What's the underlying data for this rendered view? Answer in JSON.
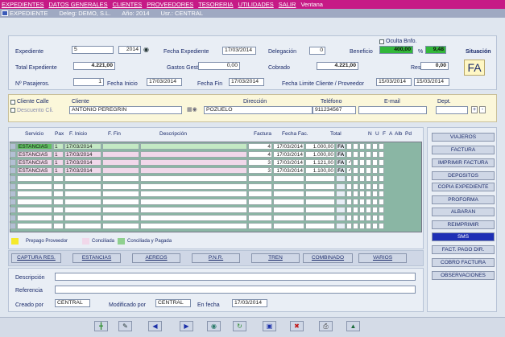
{
  "menu": [
    "EXPEDIENTES",
    "DATOS GENERALES",
    "CLIENTES",
    "PROVEEDORES",
    "TESORERIA",
    "UTILIDADES",
    "SALIR",
    "Ventana"
  ],
  "window": {
    "title": "EXPEDIENTE",
    "deleg": "Deleg: DEMO, S.L.",
    "year": "Año: 2014",
    "user": "Usr.: CENTRAL"
  },
  "header": {
    "expediente_label": "Expediente",
    "expediente_num": "5",
    "expediente_year": "2014",
    "fecha_exp_label": "Fecha Expediente",
    "fecha_exp": "17/03/2014",
    "delegacion_label": "Delegación",
    "delegacion": "0",
    "oculta_label": "Oculta Bnfo.",
    "beneficio_label": "Beneficio",
    "beneficio": "400,00",
    "pct_label": "%",
    "pct": "9,48",
    "situacion_label": "Situación",
    "situacion": "FA",
    "total_label": "Total Expediente",
    "total": "4.221,00",
    "gastos_label": "Gastos Gestión",
    "gastos": "0,00",
    "cobrado_label": "Cobrado",
    "cobrado": "4.221,00",
    "resto_label": "Resto",
    "resto": "0,00",
    "pasajeros_label": "Nº Pasajeros.",
    "pasajeros": "1",
    "fecha_inicio_label": "Fecha Inicio",
    "fecha_inicio": "17/03/2014",
    "fecha_fin_label": "Fecha Fin",
    "fecha_fin": "17/03/2014",
    "fecha_limite_label": "Fecha Limite Cliente / Proveedor",
    "fecha_limite_cli": "15/03/2014",
    "fecha_limite_prov": "15/03/2014"
  },
  "client": {
    "cliente_calle_label": "Cliente Calle",
    "descuento_label": "Descuento Cli.",
    "cliente_label": "Cliente",
    "cliente": "ANTONIO PEREGRIN",
    "direccion_label": "Dirección",
    "direccion": "POZUELO",
    "telefono_label": "Teléfono",
    "telefono": "911234567",
    "email_label": "E-mail",
    "email": "",
    "dept_label": "Dept.",
    "dept": ""
  },
  "services": {
    "columns": [
      "Servicio",
      "Pax",
      "F. Inicio",
      "F. Fin",
      "Descripción",
      "Factura",
      "Fecha Fac.",
      "Total",
      "N",
      "U",
      "F",
      "A",
      "Alb",
      "Pd"
    ],
    "rows": [
      {
        "servicio": "ESTANCIAS",
        "pax": "1",
        "inicio": "17/03/2014",
        "fin": "",
        "desc": "",
        "factura": "4",
        "fecha": "17/03/2014",
        "total": "1.000,00",
        "flag": "FA"
      },
      {
        "servicio": "ESTANCIAS",
        "pax": "1",
        "inicio": "17/03/2014",
        "fin": "",
        "desc": "",
        "factura": "4",
        "fecha": "17/03/2014",
        "total": "1.000,00",
        "flag": "FA"
      },
      {
        "servicio": "ESTANCIAS",
        "pax": "1",
        "inicio": "17/03/2014",
        "fin": "",
        "desc": "",
        "factura": "3",
        "fecha": "17/03/2014",
        "total": "1.121,00",
        "flag": "FA"
      },
      {
        "servicio": "ESTANCIAS",
        "pax": "1",
        "inicio": "17/03/2014",
        "fin": "",
        "desc": "",
        "factura": "3",
        "fecha": "17/03/2014",
        "total": "1.100,00",
        "flag": "FA"
      }
    ]
  },
  "legend": [
    "Prepago Proveedor",
    "Conciliada",
    "Conciliada y Pagada"
  ],
  "legend_colors": [
    "#f5e92a",
    "#f1d8ea",
    "#8fd08f"
  ],
  "bottom_tabs": [
    "CAPTURA RES.",
    "ESTANCIAS",
    "AEREOS",
    "P.N.R.",
    "TREN",
    "COMBINADO",
    "VARIOS"
  ],
  "side_buttons": [
    "VIAJEROS",
    "FACTURA",
    "IMPRIMIR FACTURA",
    "DEPOSITOS",
    "COPIA EXPEDIENTE",
    "PROFORMA",
    "ALBARAN",
    "REIMPRIMIR",
    "SMS",
    "FACT. PAGO DIR.",
    "COBRO FACTURA",
    "OBSERVACIONES"
  ],
  "footer": {
    "descripcion_label": "Descripción",
    "descripcion": "",
    "referencia_label": "Referencia",
    "referencia": "",
    "creado_label": "Creado por",
    "creado": "CENTRAL",
    "modificado_label": "Modificado por",
    "modificado": "CENTRAL",
    "fecha_label": "En fecha",
    "fecha": "17/03/2014"
  },
  "toolbar_icons": [
    "add-icon",
    "edit-icon",
    "prev-icon",
    "next-icon",
    "search-icon",
    "refresh-icon",
    "save-icon",
    "delete-icon",
    "print-icon",
    "exit-icon"
  ]
}
